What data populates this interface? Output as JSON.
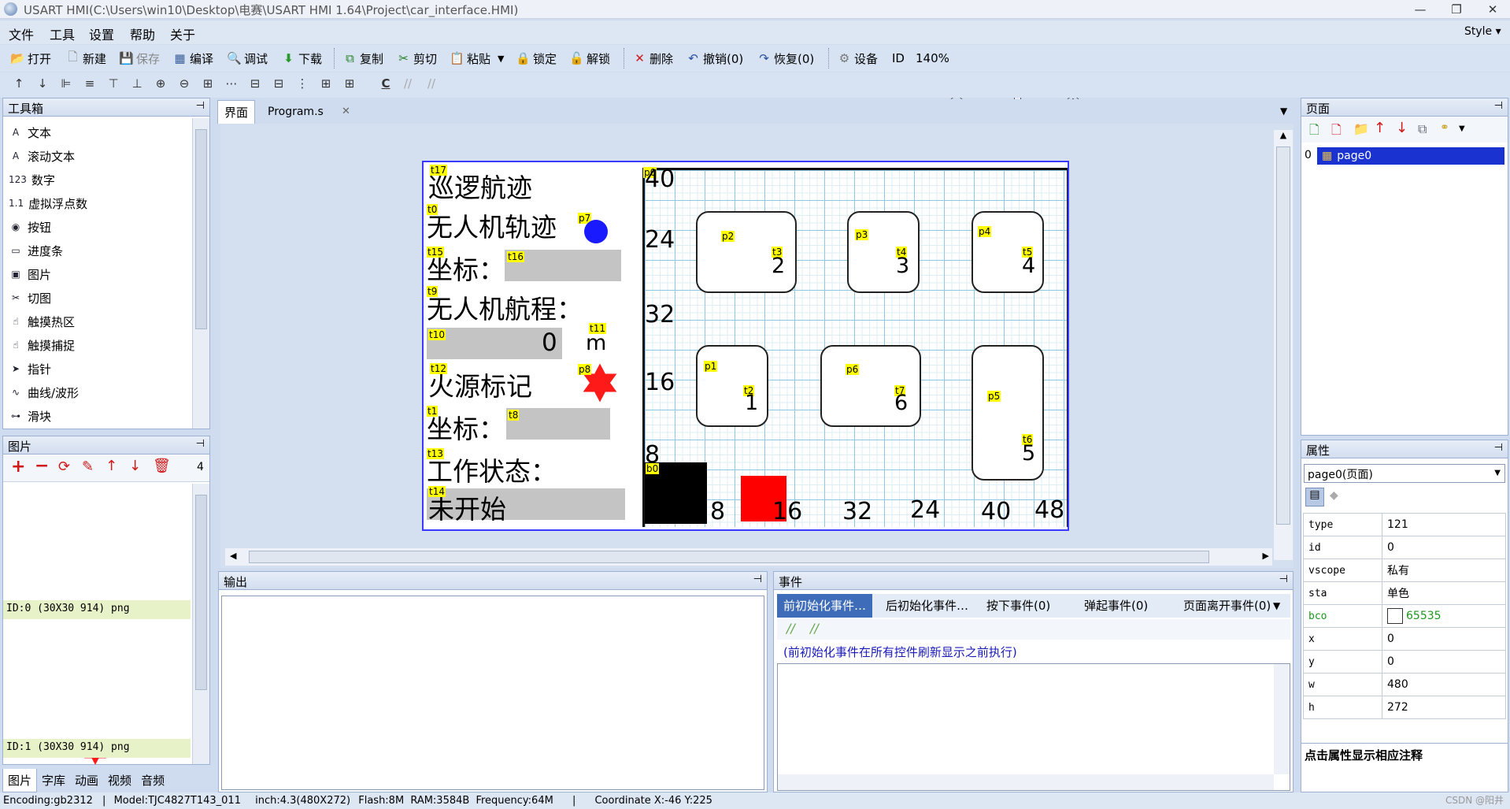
{
  "title": "USART HMI(C:\\Users\\win10\\Desktop\\电赛\\USART HMI 1.64\\Project\\car_interface.HMI)",
  "menu": [
    "文件",
    "工具",
    "设置",
    "帮助",
    "关于"
  ],
  "style_label": "Style",
  "toolbar": {
    "open": "打开",
    "new": "新建",
    "save": "保存",
    "compile": "编译",
    "debug": "调试",
    "download": "下载",
    "copy": "复制",
    "cut": "剪切",
    "paste": "粘贴",
    "lock": "锁定",
    "unlock": "解锁",
    "delete": "删除",
    "undo": "撤销(0)",
    "redo": "恢复(0)",
    "device": "设备",
    "id": "ID",
    "zoom": "140%"
  },
  "toolbox": {
    "title": "工具箱",
    "items": [
      "文本",
      "滚动文本",
      "数字",
      "虚拟浮点数",
      "按钮",
      "进度条",
      "图片",
      "切图",
      "触摸热区",
      "触摸捕捉",
      "指针",
      "曲线/波形",
      "滑块"
    ],
    "icons": [
      "A",
      "A",
      "123",
      "1.1",
      "◉",
      "▭",
      "▣",
      "✂",
      "☝",
      "☝",
      "➤",
      "∿",
      "⊶"
    ]
  },
  "pictures": {
    "title": "图片",
    "count": "4",
    "items": [
      "ID:0  (30X30 914) png",
      "ID:1  (30X30 914) png"
    ]
  },
  "bottom_tabs": [
    "图片",
    "字库",
    "动画",
    "视频",
    "音频"
  ],
  "doc_tabs": {
    "tab1": "界面",
    "tab2": "Program.s"
  },
  "hmi": {
    "labels": {
      "t17": "t17",
      "t0": "t0",
      "t15": "t15",
      "t16": "t16",
      "t9": "t9",
      "t10": "t10",
      "t11": "t11",
      "t12": "t12",
      "p8": "p8",
      "t1": "t1",
      "t8": "t8",
      "t13": "t13",
      "t14": "t14",
      "p7": "p7",
      "p0": "p0",
      "p1": "p1",
      "p2": "p2",
      "p3": "p3",
      "p4": "p4",
      "p5": "p5",
      "p6": "p6",
      "t2": "t2",
      "t3": "t3",
      "t4": "t4",
      "t5": "t5",
      "t6": "t6",
      "t7": "t7",
      "b0": "b0"
    },
    "texts": {
      "patrol": "巡逻航迹",
      "drone_track": "无人机轨迹",
      "coord1": "坐标：",
      "drone_range": "无人机航程：",
      "range_value": "0",
      "range_unit": "m",
      "fire_mark": "火源标记",
      "coord2": "坐标：",
      "work_status": "工作状态：",
      "not_started": "未开始"
    },
    "axis_left": [
      "40",
      "24",
      "32",
      "16",
      "8"
    ],
    "axis_bottom": [
      "8",
      "16",
      "32",
      "24",
      "40",
      "48"
    ],
    "box_digits": {
      "t2": "1",
      "t3": "2",
      "t4": "3",
      "t5": "4",
      "t6": "5",
      "t7": "6"
    },
    "colors": {
      "dot": "#1a1aff",
      "star": "#ff1a1a",
      "black_square": "#000000",
      "red_square": "#ff0000"
    }
  },
  "output": {
    "title": "输出"
  },
  "events": {
    "title": "事件",
    "tabs": [
      "前初始化事件…",
      "后初始化事件…",
      "按下事件(0)",
      "弹起事件(0)",
      "页面离开事件(0)"
    ],
    "description": "(前初始化事件在所有控件刷新显示之前执行)"
  },
  "pages": {
    "title": "页面",
    "index": "0",
    "items": [
      "page0"
    ]
  },
  "properties": {
    "title": "属性",
    "selector": "page0(页面)",
    "rows": [
      [
        "type",
        "121"
      ],
      [
        "id",
        "0"
      ],
      [
        "vscope",
        "私有"
      ],
      [
        "sta",
        "单色"
      ],
      [
        "bco",
        "65535"
      ],
      [
        "x",
        "0"
      ],
      [
        "y",
        "0"
      ],
      [
        "w",
        "480"
      ],
      [
        "h",
        "272"
      ]
    ],
    "hint": "点击属性显示相应注释"
  },
  "status": {
    "encoding": "Encoding:gb2312",
    "model": "Model:TJC4827T143_011",
    "inch": "inch:4.3(480X272)",
    "flash": "Flash:8M",
    "ram": "RAM:3584B",
    "freq": "Frequency:64M",
    "coord": "Coordinate X:-46   Y:225",
    "watermark": "CSDN @阳井"
  }
}
